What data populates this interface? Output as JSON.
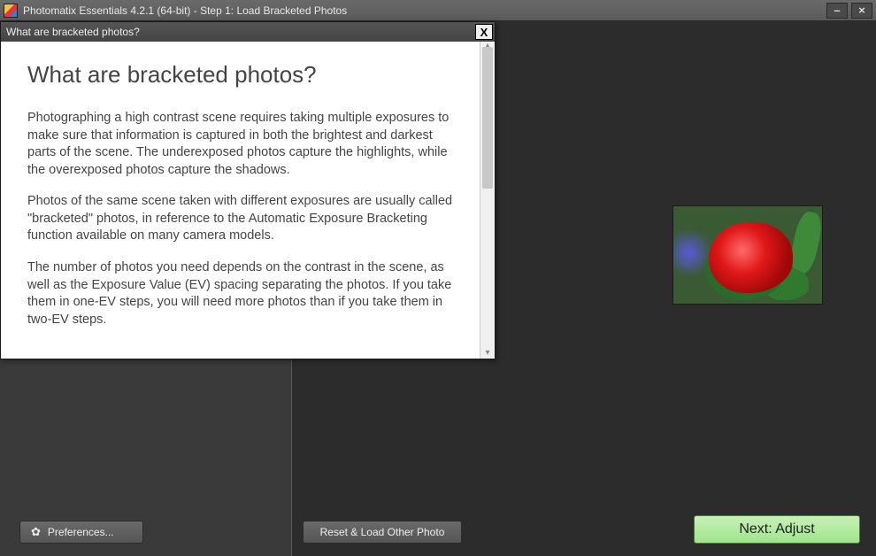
{
  "titlebar": {
    "title": "Photomatix Essentials  4.2.1 (64-bit) - Step 1: Load Bracketed Photos",
    "minimize": "–",
    "close": "×"
  },
  "help": {
    "header": "What are bracketed photos?",
    "close": "X",
    "heading": "What are bracketed photos?",
    "p1": "Photographing a high contrast scene requires taking multiple exposures to make sure that information is captured in both the brightest and darkest parts of the scene. The underexposed photos capture the highlights, while the overexposed photos capture the shadows.",
    "p2": "Photos of the same scene taken with different exposures are usually called \"bracketed\" photos, in reference to the Automatic Exposure Bracketing function available on many camera models.",
    "p3": "The number of photos you need depends on the contrast in the scene, as well as the Exposure Value (EV) spacing separating the photos. If you take them in one-EV steps, you will need more photos than if you take them in two-EV steps."
  },
  "buttons": {
    "preferences": "Preferences...",
    "reset": "Reset & Load Other Photo",
    "next": "Next: Adjust"
  },
  "icons": {
    "gear": "✿"
  }
}
